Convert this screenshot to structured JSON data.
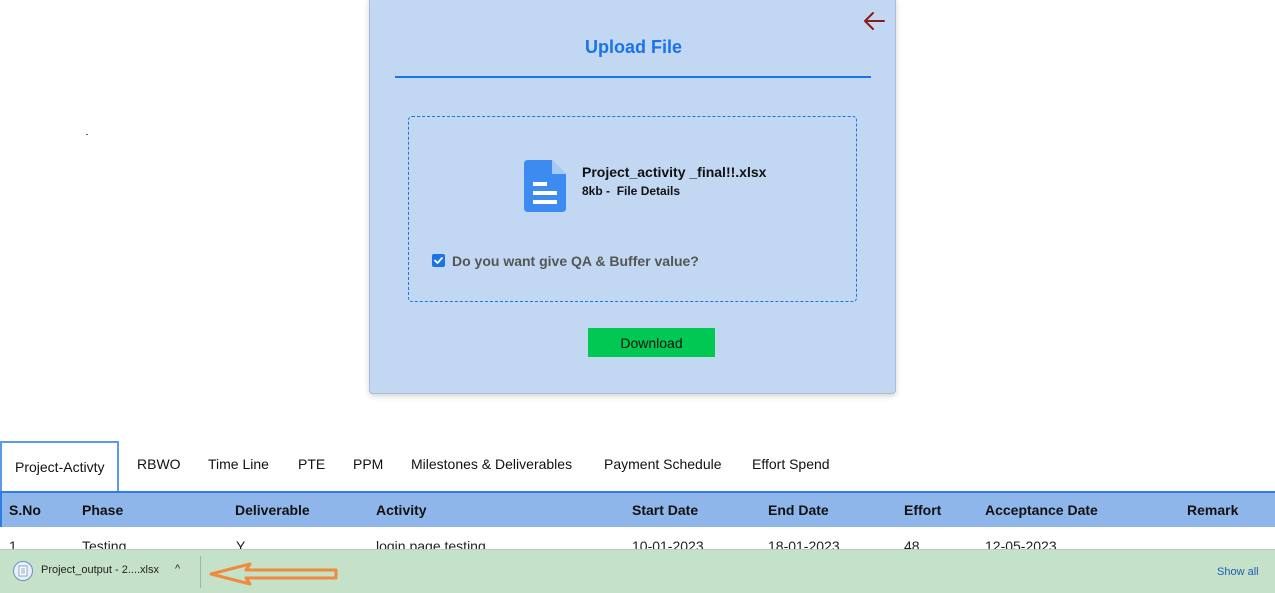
{
  "upload_card": {
    "title": "Upload File",
    "back_icon": "arrow-left-icon",
    "file": {
      "icon": "document-icon",
      "name": "Project_activity _final!!.xlsx",
      "size": "8kb",
      "details_link": "File Details",
      "meta_separator": " -  "
    },
    "qa_checkbox": {
      "label": "Do you want give QA & Buffer value?",
      "checked": true
    },
    "download_button": "Download",
    "colors": {
      "card_bg": "#c2d7f1",
      "accent": "#1a73e8",
      "download": "#00c853",
      "back_arrow": "#8b1a1a"
    }
  },
  "tabs": [
    {
      "label": "Project-Activty",
      "active": true
    },
    {
      "label": "RBWO"
    },
    {
      "label": "Time Line"
    },
    {
      "label": "PTE"
    },
    {
      "label": "PPM"
    },
    {
      "label": "Milestones & Deliverables"
    },
    {
      "label": "Payment Schedule"
    },
    {
      "label": "Effort Spend"
    }
  ],
  "table": {
    "headers": [
      "S.No",
      "Phase",
      "Deliverable",
      "Activity",
      "Start Date",
      "End Date",
      "Effort",
      "Acceptance Date",
      "Remark"
    ],
    "rows": [
      [
        "1",
        "Testing",
        "Y",
        "login page testing",
        "10-01-2023",
        "18-01-2023",
        "48",
        "12-05-2023",
        ""
      ]
    ],
    "colors": {
      "header_bg": "#8fb6ea",
      "header_border": "#2f7de1"
    }
  },
  "download_bar": {
    "file_name": "Project_output - 2....xlsx",
    "file_icon": "file-icon",
    "chevron": "^",
    "show_all": "Show all",
    "annotation_icon": "orange-arrow-annotation-icon",
    "colors": {
      "bar_bg": "#c5e1c7",
      "annotation": "#f08a3c"
    }
  }
}
